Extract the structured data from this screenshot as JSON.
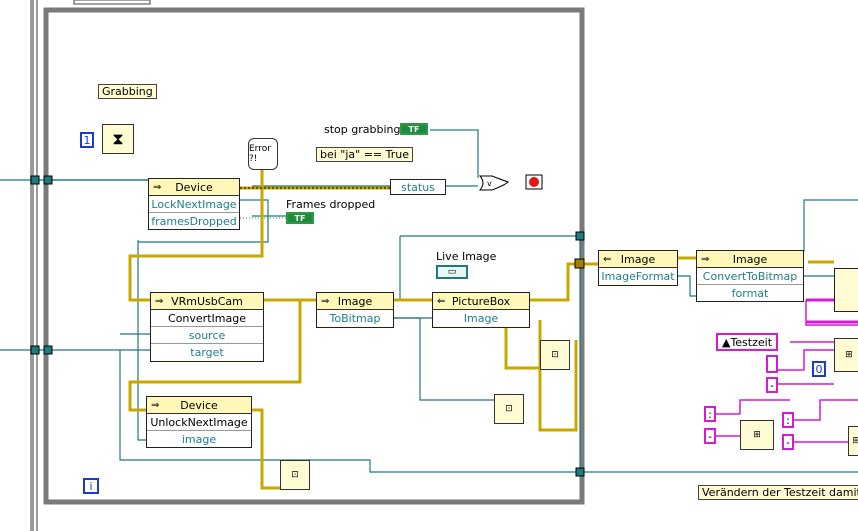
{
  "labels": {
    "grabbing": "Grabbing",
    "stop_grabbing": "stop grabbing",
    "condition": "bei \"ja\" == True",
    "frames_dropped": "Frames dropped",
    "live_image": "Live Image",
    "status": "status",
    "testzeit_note": "Verändern der Testzeit damit",
    "testzeit": "Testzeit",
    "iteration": "i",
    "constant_one": "1",
    "constant_zero": "0",
    "tf": "TF",
    "error": "Error ?!"
  },
  "nodes": {
    "device_lock": {
      "class": "Device",
      "rows": [
        "LockNextImage",
        "framesDropped"
      ]
    },
    "vrm_cam": {
      "class": "VRmUsbCam",
      "rows": [
        "ConvertImage",
        "source",
        "target"
      ]
    },
    "image_bitmap": {
      "class": "Image",
      "rows": [
        "ToBitmap"
      ]
    },
    "picturebox": {
      "class": "PictureBox",
      "rows": [
        "Image"
      ]
    },
    "image_format": {
      "class": "Image",
      "rows": [
        "ImageFormat"
      ]
    },
    "image_convert": {
      "class": "Image",
      "rows": [
        "ConvertToBitmap",
        "format"
      ]
    },
    "device_unlock": {
      "class": "Device",
      "rows": [
        "UnlockNextImage",
        "image"
      ]
    }
  },
  "colors": {
    "wire_teal": "#1f7a80",
    "wire_yellow": "#c8a800",
    "frame_gray": "#7a7a7a",
    "bool_green": "#1f8a3c",
    "num_blue": "#1a3cc7",
    "pink": "#d61ad6"
  }
}
